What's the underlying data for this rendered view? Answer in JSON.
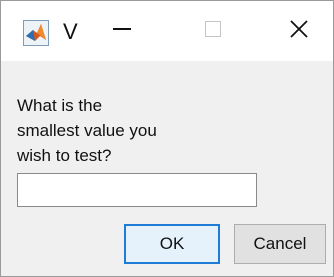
{
  "window": {
    "title": "V",
    "app_icon": "matlab-logo-icon",
    "controls": {
      "minimize": "minimize-icon",
      "maximize": "maximize-icon",
      "close": "close-icon"
    }
  },
  "dialog": {
    "prompt": "What is the\nsmallest value you\nwish to test?",
    "input_value": "",
    "ok_label": "OK",
    "cancel_label": "Cancel"
  },
  "colors": {
    "client_background": "#f0f0f0",
    "ok_border": "#1e7bd6",
    "ok_background": "#e5f1fb",
    "cancel_background": "#e1e1e1"
  }
}
